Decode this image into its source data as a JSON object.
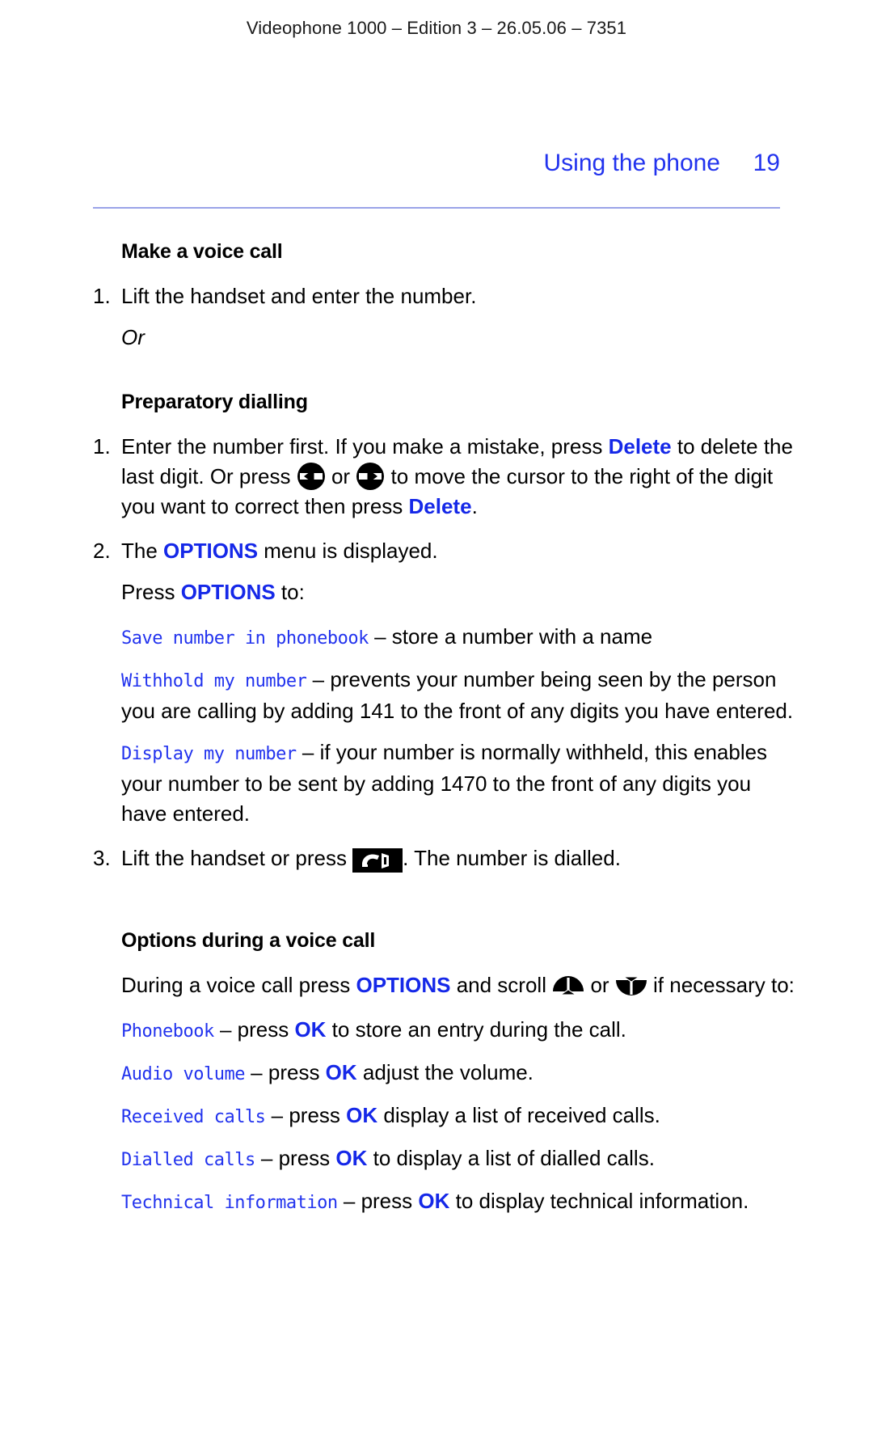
{
  "doc": {
    "running_head": "Videophone 1000 – Edition 3 – 26.05.06 – 7351",
    "chapter_title": "Using the phone",
    "page_number": "19",
    "accent_color": "#2233ee",
    "rule_color": "#9aa3e8"
  },
  "sections": {
    "make_voice_call": {
      "heading": "Make a voice call",
      "item1_num": "1.",
      "item1_text": "Lift the handset and enter the number.",
      "or": "Or"
    },
    "preparatory_dialling": {
      "heading": "Preparatory dialling",
      "item1_num": "1.",
      "item1_a": "Enter the number first. If you make a mistake, press ",
      "item1_delete1": "Delete",
      "item1_b": " to delete the last digit. Or press ",
      "item1_or": " or ",
      "item1_c": " to move the cursor to the right of the digit you want to correct then press ",
      "item1_delete2": "Delete",
      "item1_d": ".",
      "item2_num": "2.",
      "item2_a": "The ",
      "item2_options": "OPTIONS",
      "item2_b": " menu is displayed.",
      "press_a": "Press ",
      "press_options": "OPTIONS",
      "press_b": " to:",
      "options": [
        {
          "lcd": "Save number in phonebook",
          "desc": " – store a number with a name"
        },
        {
          "lcd": "Withhold my number",
          "desc": " – prevents your number being seen by the person you are calling by adding 141 to the front of any digits you have entered."
        },
        {
          "lcd": "Display my number",
          "desc": " – if your number is normally withheld, this enables your number to be sent by adding 1470 to the front of any digits you have entered."
        }
      ],
      "item3_num": "3.",
      "item3_a": "Lift the handset or press ",
      "item3_b": ". The number is dialled."
    },
    "options_during_call": {
      "heading": "Options during a voice call",
      "intro_a": "During a voice call press ",
      "intro_options": "OPTIONS",
      "intro_b": " and scroll ",
      "intro_or": " or ",
      "intro_c": " if necessary to:",
      "items": [
        {
          "lcd": "Phonebook",
          "mid": " – press ",
          "ok": "OK",
          "tail": " to store an entry during the call."
        },
        {
          "lcd": "Audio volume",
          "mid": " – press ",
          "ok": "OK",
          "tail": " adjust the volume."
        },
        {
          "lcd": "Received calls",
          "mid": " – press ",
          "ok": "OK",
          "tail": " display a list of received calls."
        },
        {
          "lcd": "Dialled calls",
          "mid": " – press ",
          "ok": "OK",
          "tail": " to display a list of dialled calls."
        },
        {
          "lcd": "Technical information",
          "mid": " – press ",
          "ok": "OK",
          "tail": " to display technical information."
        }
      ]
    }
  },
  "icons": {
    "left_arrow_key": "left-arrow-key-icon",
    "right_arrow_key": "right-arrow-key-icon",
    "handset_key": "handset-key-icon",
    "scroll_up_key": "scroll-up-key-icon",
    "scroll_down_key": "scroll-down-key-icon"
  }
}
